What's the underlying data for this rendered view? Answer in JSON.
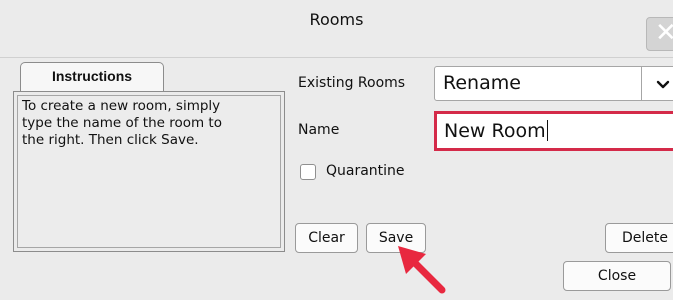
{
  "window": {
    "title": "Rooms",
    "close_glyph": "✕"
  },
  "instructions": {
    "tab_label": "Instructions",
    "lines": [
      "To create a new room, simply",
      "type the name of the room to",
      "the right. Then click Save."
    ]
  },
  "form": {
    "existing_rooms_label": "Existing Rooms",
    "existing_rooms_value": "Rename",
    "dropdown_glyph": "⌄",
    "name_label": "Name",
    "name_value": "New Room",
    "quarantine_label": "Quarantine",
    "quarantine_checked": false
  },
  "buttons": {
    "clear": "Clear",
    "save": "Save",
    "delete": "Delete",
    "close": "Close"
  },
  "colors": {
    "focus_border": "#d42a49",
    "annotation_arrow": "#e8283f"
  },
  "icons": {
    "close": "close-icon",
    "dropdown": "chevron-down-icon",
    "pointer": "annotation-arrow-icon"
  }
}
